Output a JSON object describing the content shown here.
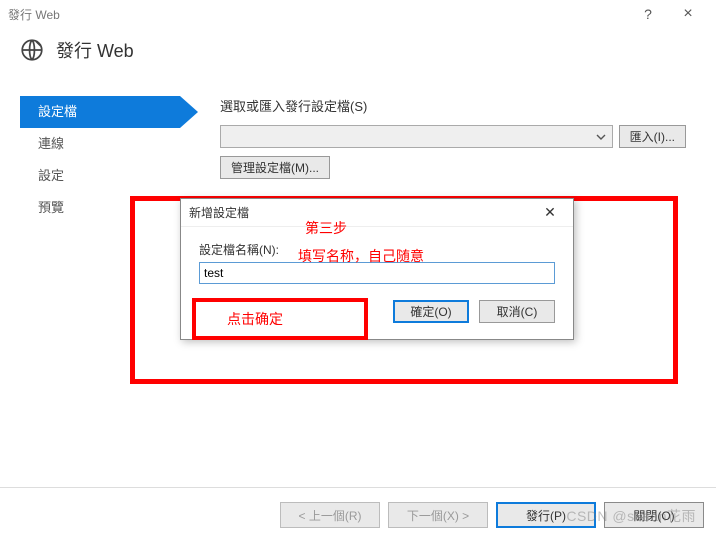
{
  "window": {
    "title": "發行 Web",
    "help_glyph": "?",
    "close_glyph": "×"
  },
  "header": {
    "title": "發行 Web"
  },
  "sidebar": {
    "items": [
      {
        "label": "設定檔",
        "active": true
      },
      {
        "label": "連線"
      },
      {
        "label": "設定"
      },
      {
        "label": "預覽"
      }
    ]
  },
  "main": {
    "select_label": "選取或匯入發行設定檔(S)",
    "combo_value": "",
    "import_btn": "匯入(I)...",
    "manage_btn": "管理設定檔(M)..."
  },
  "modal": {
    "title": "新增設定檔",
    "close_glyph": "✕",
    "name_label": "設定檔名稱(N):",
    "name_value": "test",
    "ok": "確定(O)",
    "cancel": "取消(C)"
  },
  "annotations": {
    "step": "第三步",
    "hint": "填写名称，自己随意",
    "click_ok": "点击确定"
  },
  "footer": {
    "prev": "< 上一個(R)",
    "next": "下一個(X) >",
    "publish": "發行(P)",
    "close": "關閉(O)"
  },
  "watermark": "CSDN @susan花雨"
}
